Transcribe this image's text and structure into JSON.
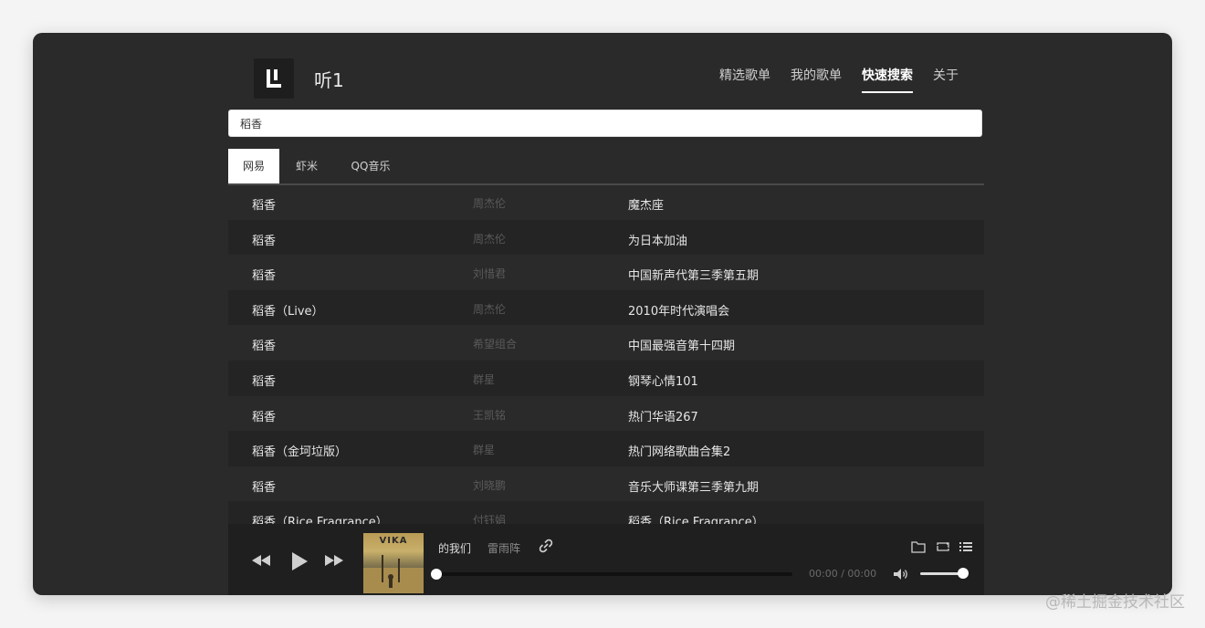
{
  "app": {
    "title": "听1"
  },
  "nav": {
    "items": [
      {
        "label": "精选歌单"
      },
      {
        "label": "我的歌单"
      },
      {
        "label": "快速搜索"
      },
      {
        "label": "关于"
      }
    ],
    "active_index": 2
  },
  "search": {
    "value": "稻香"
  },
  "tabs": {
    "items": [
      {
        "label": "网易"
      },
      {
        "label": "虾米"
      },
      {
        "label": "QQ音乐"
      }
    ],
    "active_index": 0
  },
  "results": [
    {
      "title": "稻香",
      "artist": "周杰伦",
      "album": "魔杰座"
    },
    {
      "title": "稻香",
      "artist": "周杰伦",
      "album": "为日本加油"
    },
    {
      "title": "稻香",
      "artist": "刘惜君",
      "album": "中国新声代第三季第五期"
    },
    {
      "title": "稻香（Live）",
      "artist": "周杰伦",
      "album": "2010年时代演唱会"
    },
    {
      "title": "稻香",
      "artist": "希望组合",
      "album": "中国最强音第十四期"
    },
    {
      "title": "稻香",
      "artist": "群星",
      "album": "钢琴心情101"
    },
    {
      "title": "稻香",
      "artist": "王凯铭",
      "album": "热门华语267"
    },
    {
      "title": "稻香（金坷垃版）",
      "artist": "群星",
      "album": "热门网络歌曲合集2"
    },
    {
      "title": "稻香",
      "artist": "刘晓鹏",
      "album": "音乐大师课第三季第九期"
    },
    {
      "title": "稻香（Rice Fragrance）",
      "artist": "付钰娟",
      "album": "稻香（Rice Fragrance）"
    }
  ],
  "player": {
    "cover_text": "VIKA",
    "track_title": "的我们",
    "track_artist": "雷雨阵",
    "time": "00:00 / 00:00",
    "progress": 0,
    "volume": 0.9
  },
  "watermark": "@稀土掘金技术社区",
  "icons": {
    "prev": "prev-icon",
    "play": "play-icon",
    "next": "next-icon",
    "link": "link-icon",
    "volume": "volume-icon",
    "folder": "folder-icon",
    "repeat": "repeat-icon",
    "playlist": "playlist-icon"
  }
}
